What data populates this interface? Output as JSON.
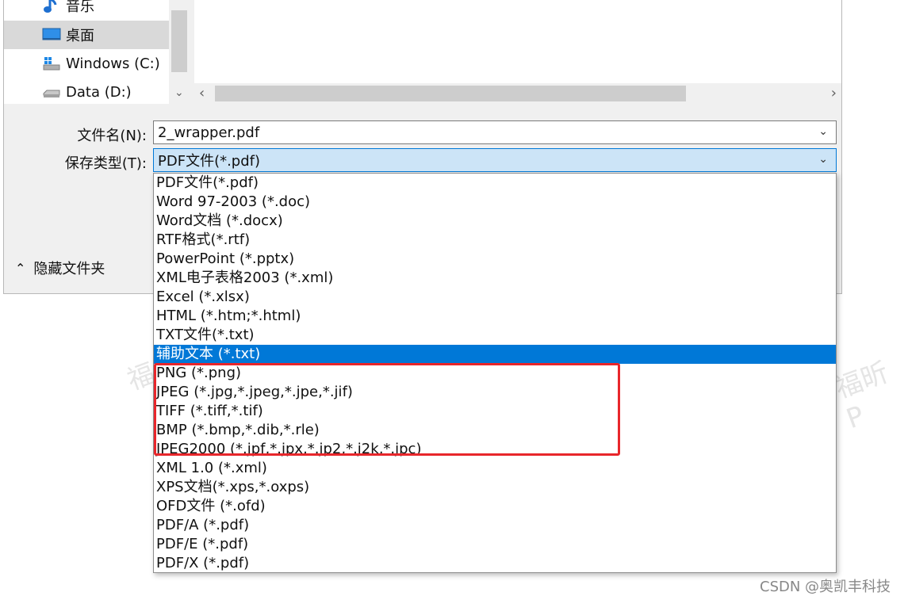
{
  "nav": {
    "items": [
      {
        "label": "音乐",
        "icon": "music-icon"
      },
      {
        "label": "桌面",
        "icon": "desktop-icon",
        "selected": true
      },
      {
        "label": "Windows (C:)",
        "icon": "windows-drive-icon"
      },
      {
        "label": "Data (D:)",
        "icon": "drive-icon"
      }
    ]
  },
  "form": {
    "filename_label": "文件名(N):",
    "filename_value": "2_wrapper.pdf",
    "type_label": "保存类型(T):",
    "type_value": "PDF文件(*.pdf)"
  },
  "hide_folders_label": "隐藏文件夹",
  "dropdown": {
    "options": [
      "PDF文件(*.pdf)",
      "Word 97-2003 (*.doc)",
      "Word文档 (*.docx)",
      "RTF格式(*.rtf)",
      "PowerPoint (*.pptx)",
      "XML电子表格2003 (*.xml)",
      "Excel (*.xlsx)",
      "HTML (*.htm;*.html)",
      "TXT文件(*.txt)",
      "辅助文本 (*.txt)",
      "PNG (*.png)",
      "JPEG (*.jpg,*.jpeg,*.jpe,*.jif)",
      "TIFF (*.tiff,*.tif)",
      "BMP (*.bmp,*.dib,*.rle)",
      "JPEG2000 (*.jpf,*.jpx,*.jp2,*.j2k,*.jpc)",
      "XML 1.0 (*.xml)",
      "XPS文档(*.xps,*.oxps)",
      "OFD文件 (*.ofd)",
      "PDF/A (*.pdf)",
      "PDF/E (*.pdf)",
      "PDF/X (*.pdf)"
    ],
    "highlighted_index": 9
  },
  "watermark": {
    "left": "福",
    "right": "福昕P"
  },
  "footer": "CSDN @奥凯丰科技",
  "colors": {
    "highlight": "#0078d7",
    "annotation_box": "#e8262b"
  }
}
